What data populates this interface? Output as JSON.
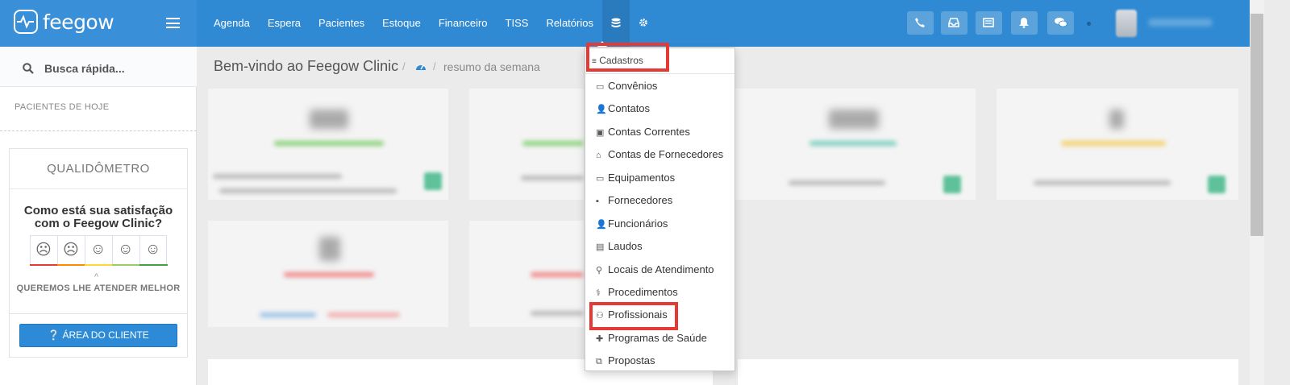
{
  "brand": {
    "name": "feegow"
  },
  "nav": {
    "items": [
      "Agenda",
      "Espera",
      "Pacientes",
      "Estoque",
      "Financeiro",
      "TISS",
      "Relatórios"
    ]
  },
  "sidebar": {
    "search_label": "Busca rápida...",
    "section_label": "PACIENTES DE HOJE",
    "qual_title": "QUALIDÔMETRO",
    "qual_question_1": "Como está sua satisfação",
    "qual_question_2": "com o Feegow Clinic?",
    "qual_footer": "QUEREMOS LHE ATENDER MELHOR",
    "client_button": "ÁREA DO CLIENTE",
    "faces": [
      {
        "glyph": "☹",
        "color": "#e53935"
      },
      {
        "glyph": "☹",
        "color": "#fb8c00"
      },
      {
        "glyph": "☺",
        "color": "#fdd835"
      },
      {
        "glyph": "☺",
        "color": "#9ccc65"
      },
      {
        "glyph": "☺",
        "color": "#43a047"
      }
    ]
  },
  "main": {
    "title": "Bem-vindo ao Feegow Clinic",
    "breadcrumb": "resumo da semana"
  },
  "dropdown": {
    "header": "Cadastros",
    "items": [
      {
        "label": "Convênios",
        "icon": "▭"
      },
      {
        "label": "Contatos",
        "icon": "👤"
      },
      {
        "label": "Contas Correntes",
        "icon": "▣"
      },
      {
        "label": "Contas de Fornecedores",
        "icon": "⌂"
      },
      {
        "label": "Equipamentos",
        "icon": "▭"
      },
      {
        "label": "Fornecedores",
        "icon": "▪"
      },
      {
        "label": "Funcionários",
        "icon": "👤"
      },
      {
        "label": "Laudos",
        "icon": "▤"
      },
      {
        "label": "Locais de Atendimento",
        "icon": "⚲"
      },
      {
        "label": "Procedimentos",
        "icon": "⚕"
      },
      {
        "label": "Profissionais",
        "icon": "⚇"
      },
      {
        "label": "Programas de Saúde",
        "icon": "✚"
      },
      {
        "label": "Propostas",
        "icon": "⧉"
      }
    ]
  },
  "colors": {
    "topbar": "#2f8ad3",
    "highlight": "#e53935",
    "button": "#2d8ad6"
  }
}
